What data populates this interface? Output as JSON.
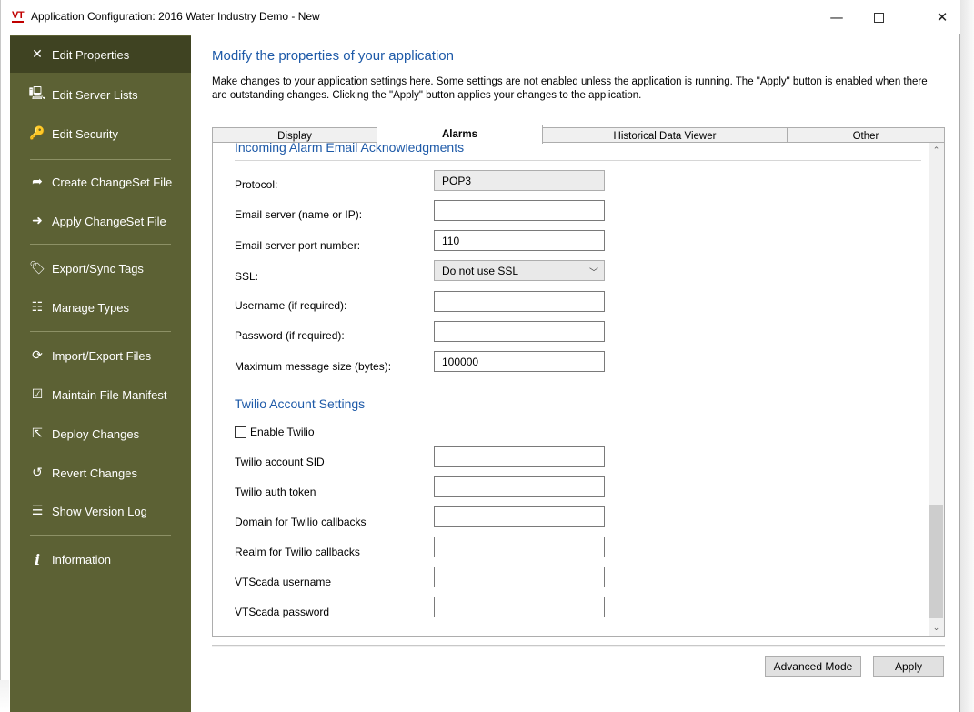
{
  "window": {
    "logo_text": "VT",
    "title": "Application Configuration: 2016 Water Industry Demo - New",
    "minimize_glyph": "—",
    "close_glyph": "✕"
  },
  "sidebar": {
    "items": [
      {
        "label": "Edit Properties",
        "icon": "tools-icon",
        "glyph": "✕"
      },
      {
        "label": "Edit Server Lists",
        "icon": "server-list-icon",
        "glyph": "🖳"
      },
      {
        "label": "Edit Security",
        "icon": "key-icon",
        "glyph": "🔑"
      },
      {
        "label": "Create ChangeSet File",
        "icon": "create-file-icon",
        "glyph": "➦"
      },
      {
        "label": "Apply ChangeSet File",
        "icon": "apply-file-icon",
        "glyph": "➜"
      },
      {
        "label": "Export/Sync Tags",
        "icon": "tag-icon",
        "glyph": "🏷"
      },
      {
        "label": "Manage Types",
        "icon": "manage-types-icon",
        "glyph": "☷"
      },
      {
        "label": "Import/Export Files",
        "icon": "sync-icon",
        "glyph": "⟳"
      },
      {
        "label": "Maintain File Manifest",
        "icon": "checkbox-icon",
        "glyph": "☑"
      },
      {
        "label": "Deploy Changes",
        "icon": "deploy-icon",
        "glyph": "⇱"
      },
      {
        "label": "Revert Changes",
        "icon": "revert-icon",
        "glyph": "↺"
      },
      {
        "label": "Show Version Log",
        "icon": "list-icon",
        "glyph": "☰"
      },
      {
        "label": "Information",
        "icon": "info-icon",
        "glyph": "i"
      }
    ]
  },
  "main": {
    "title": "Modify the properties of your application",
    "description": "Make changes to your application settings here. Some settings are not enabled unless the application is running. The \"Apply\" button is enabled when there are outstanding changes. Clicking the \"Apply\" button applies your changes to the application."
  },
  "tabs": [
    {
      "label": "Display"
    },
    {
      "label": "Alarms"
    },
    {
      "label": "Historical Data Viewer"
    },
    {
      "label": "Other"
    }
  ],
  "email_section": {
    "title": "Incoming Alarm Email Acknowledgments",
    "protocol_label": "Protocol:",
    "protocol_value": "POP3",
    "server_label": "Email server (name or IP):",
    "server_value": "",
    "port_label": "Email server port number:",
    "port_value": "110",
    "ssl_label": "SSL:",
    "ssl_value": "Do not use SSL",
    "username_label": "Username (if required):",
    "username_value": "",
    "password_label": "Password (if required):",
    "password_value": "",
    "maxsize_label": "Maximum message size (bytes):",
    "maxsize_value": "100000"
  },
  "twilio_section": {
    "title": "Twilio Account Settings",
    "enable_label": "Enable Twilio",
    "enable_checked": false,
    "sid_label": "Twilio account SID",
    "token_label": "Twilio auth token",
    "domain_label": "Domain for Twilio callbacks",
    "realm_label": "Realm for Twilio callbacks",
    "vts_user_label": "VTScada username",
    "vts_pass_label": "VTScada password"
  },
  "buttons": {
    "advanced": "Advanced Mode",
    "apply": "Apply"
  },
  "colors": {
    "sidebar_bg": "#5c6134",
    "sidebar_active": "#3f4322",
    "accent_blue": "#1e5aa8"
  }
}
